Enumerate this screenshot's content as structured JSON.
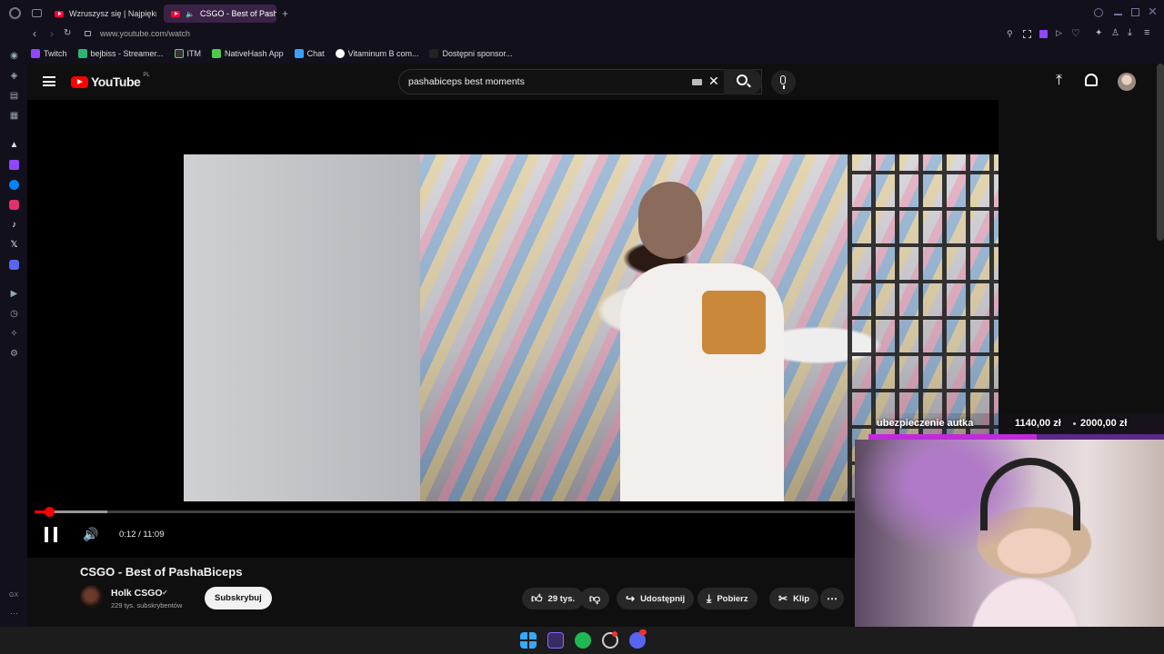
{
  "browser": {
    "tabs": [
      {
        "title": "Wzruszysz się | Najpiękn",
        "active": false
      },
      {
        "title": "CSGO - Best of Pasha",
        "active": true
      }
    ],
    "new_tab_label": "+",
    "url": "www.youtube.com/watch",
    "bookmarks": [
      {
        "label": "Twitch",
        "color": "#9146ff"
      },
      {
        "label": "bejbiss - Streamer...",
        "color": "#2bb673"
      },
      {
        "label": "ITM",
        "color": "#333333"
      },
      {
        "label": "NativeHash App",
        "color": "#4ec94e"
      },
      {
        "label": "Chat",
        "color": "#3aa0ff"
      },
      {
        "label": "Vitaminum B com...",
        "color": "#ffffff"
      },
      {
        "label": "Dostępni sponsor...",
        "color": "#222222"
      }
    ],
    "sidebar_icons": [
      "opera-icon",
      "aria-icon",
      "wallet-icon",
      "pinboard-icon",
      "arc-icon",
      "twitch-icon",
      "messenger-icon",
      "instagram-icon",
      "tiktok-icon",
      "x-icon",
      "discord-icon",
      "player-icon",
      "history-icon",
      "extensions-icon",
      "settings-icon",
      "gx-label",
      "more-icon"
    ],
    "sidebar_gx_label": "GX",
    "sidebar_more_label": "···"
  },
  "youtube": {
    "logo_text": "YouTube",
    "region": "PL",
    "search_value": "pashabiceps best moments",
    "video": {
      "title": "CSGO - Best of PashaBiceps",
      "current_time": "0:12",
      "duration": "11:09",
      "time_display": "0:12 / 11:09",
      "progress_fraction": 0.018
    },
    "channel": {
      "name": "Holk CSGO",
      "verified_mark": "✔",
      "subscribers": "229 tys. subskrybentów",
      "subscribe_label": "Subskrybuj"
    },
    "actions": {
      "likes": "29 tys.",
      "share": "Udostępnij",
      "download": "Pobierz",
      "clip": "Klip",
      "more": "⋯"
    }
  },
  "overlay": {
    "goal_label": "ubezpieczenie autka",
    "goal_current": "1140,00 zł",
    "goal_target": "2000,00 zł",
    "goal_fraction": 0.57
  },
  "colors": {
    "youtube_red": "#ff0000",
    "accent_purple": "#c02bd9",
    "tab_active": "#3a2346"
  }
}
